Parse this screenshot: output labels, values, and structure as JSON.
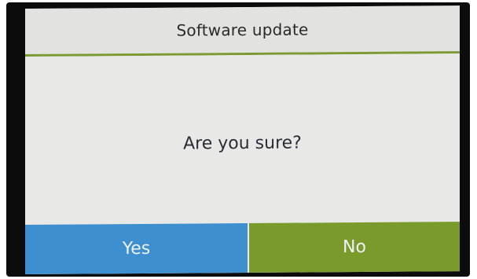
{
  "dialog": {
    "title": "Software update",
    "message": "Are you sure?",
    "yes_label": "Yes",
    "no_label": "No"
  },
  "colors": {
    "accent_line": "#7c9a33",
    "yes_button": "#3d8fcf",
    "no_button": "#7b9a2c",
    "screen_background": "#e6e6e4"
  }
}
